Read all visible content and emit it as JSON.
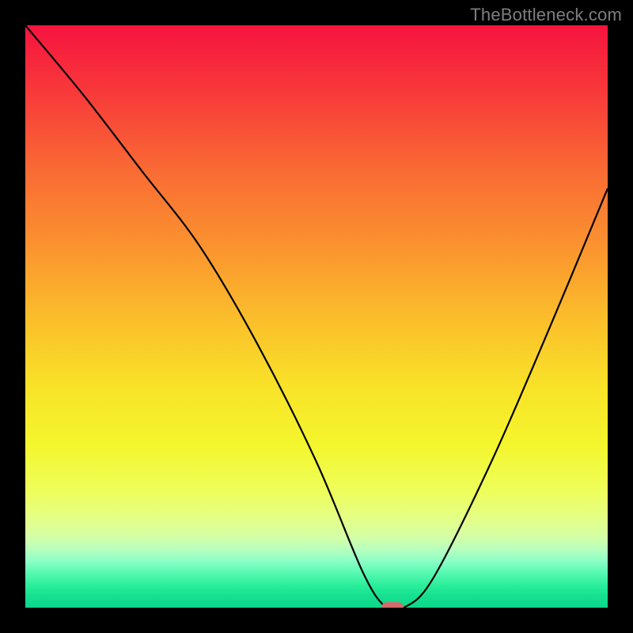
{
  "watermark": "TheBottleneck.com",
  "chart_data": {
    "type": "line",
    "title": "",
    "xlabel": "",
    "ylabel": "",
    "xlim": [
      0,
      100
    ],
    "ylim": [
      0,
      100
    ],
    "x": [
      0,
      10,
      20,
      30,
      40,
      50,
      58,
      62,
      65,
      70,
      80,
      90,
      100
    ],
    "values": [
      100,
      88,
      75,
      62,
      45,
      25,
      6,
      0,
      0,
      5,
      25,
      48,
      72
    ],
    "marker": {
      "x": 63,
      "y": 0,
      "color": "#d46a6a"
    },
    "gradient_bands": [
      {
        "at": 0,
        "color": "#f6133f"
      },
      {
        "at": 12,
        "color": "#f83b3a"
      },
      {
        "at": 25,
        "color": "#f96b34"
      },
      {
        "at": 38,
        "color": "#fb932f"
      },
      {
        "at": 50,
        "color": "#fbbd2b"
      },
      {
        "at": 62,
        "color": "#f8e228"
      },
      {
        "at": 72,
        "color": "#f4f62d"
      },
      {
        "at": 80,
        "color": "#eefe5b"
      },
      {
        "at": 85,
        "color": "#e3ff8a"
      },
      {
        "at": 88,
        "color": "#d2ffa8"
      },
      {
        "at": 90,
        "color": "#b8ffbe"
      },
      {
        "at": 92,
        "color": "#8cffc7"
      },
      {
        "at": 94,
        "color": "#58f9b2"
      },
      {
        "at": 96,
        "color": "#2bee9b"
      },
      {
        "at": 98,
        "color": "#16e191"
      },
      {
        "at": 100,
        "color": "#0cd68a"
      }
    ]
  }
}
